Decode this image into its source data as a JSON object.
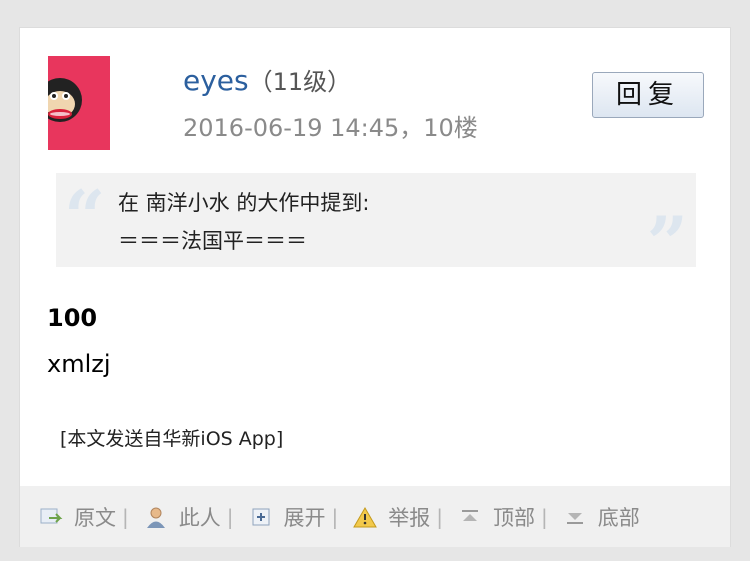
{
  "post": {
    "username": "eyes",
    "level": "（11级）",
    "meta": "2016-06-19 14:45，10楼",
    "reply_label": "回复",
    "quote": {
      "header": "在 南洋小水 的大作中提到:",
      "text": "＝＝＝法国平＝＝＝"
    },
    "body_strong": "100",
    "body_text": "xmlzj",
    "source": "[本文发送自华新iOS App]"
  },
  "actions": [
    {
      "icon": "original-text-icon",
      "label": "原文",
      "sep": "|"
    },
    {
      "icon": "person-icon",
      "label": "此人",
      "sep": "|"
    },
    {
      "icon": "expand-icon",
      "label": "展开",
      "sep": "|"
    },
    {
      "icon": "warning-icon",
      "label": "举报",
      "sep": "|"
    },
    {
      "icon": "to-top-icon",
      "label": "顶部",
      "sep": "|"
    },
    {
      "icon": "to-bottom-icon",
      "label": "底部"
    }
  ],
  "colors": {
    "username": "#2b5f9e",
    "avatar_bg": "#e8365d",
    "quote_bg": "#f2f2f2",
    "action_bar_bg": "#f0f0f0"
  }
}
